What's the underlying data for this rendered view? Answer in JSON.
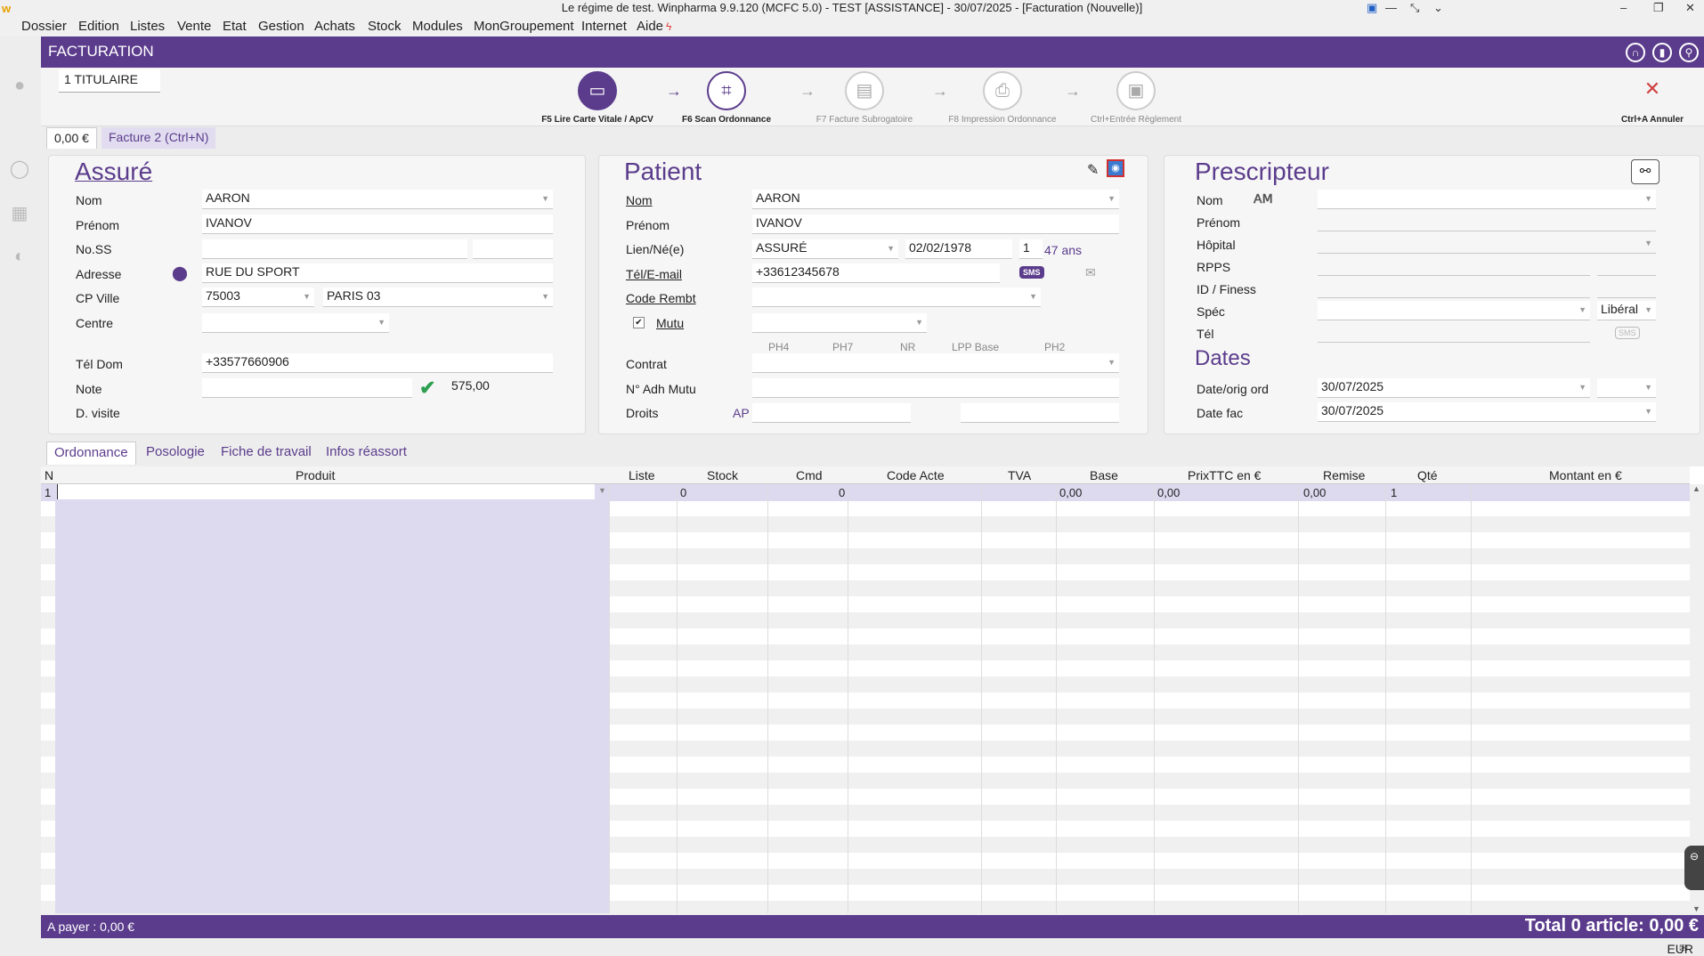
{
  "window": {
    "title": "Le régime de test. Winpharma 9.9.120  (MCFC 5.0) - TEST [ASSISTANCE] - 30/07/2025 - [Facturation (Nouvelle)]"
  },
  "menu": [
    "Dossier",
    "Edition",
    "Listes",
    "Vente",
    "Etat",
    "Gestion",
    "Achats",
    "Stock",
    "Modules",
    "MonGroupement",
    "Internet",
    "Aide"
  ],
  "header": {
    "title": "FACTURATION"
  },
  "titulaire": "1 TITULAIRE",
  "steps": [
    {
      "label": "F5 Lire Carte Vitale / ApCV"
    },
    {
      "label": "F6 Scan Ordonnance"
    },
    {
      "label": "F7 Facture Subrogatoire"
    },
    {
      "label": "F8 Impression Ordonnance"
    },
    {
      "label": "Ctrl+Entrée Règlement"
    }
  ],
  "cancel": {
    "label": "Ctrl+A Annuler"
  },
  "invoice_tabs": {
    "amount": "0,00 €",
    "new": "Facture 2 (Ctrl+N)"
  },
  "assure": {
    "title": "Assuré",
    "nom_label": "Nom",
    "nom": "AARON",
    "prenom_label": "Prénom",
    "prenom": "IVANOV",
    "noss_label": "No.SS",
    "adresse_label": "Adresse",
    "adresse": "RUE DU SPORT",
    "cpville_label": "CP Ville",
    "cp": "75003",
    "ville": "PARIS 03",
    "centre_label": "Centre",
    "teldom_label": "Tél Dom",
    "teldom": "+33577660906",
    "note_label": "Note",
    "note_value": "575,00",
    "dvisite_label": "D. visite"
  },
  "patient": {
    "title": "Patient",
    "nom_label": "Nom",
    "nom": "AARON",
    "prenom_label": "Prénom",
    "prenom": "IVANOV",
    "lien_label": "Lien/Né(e)",
    "lien": "ASSURÉ",
    "naissance": "02/02/1978",
    "rang": "1",
    "age": "47 ans",
    "tel_label": "Tél/E-mail",
    "tel": "+33612345678",
    "sms": "SMS",
    "coderembt_label": "Code Rembt",
    "mutu_label": "Mutu",
    "ph_headers": [
      "PH4",
      "PH7",
      "NR",
      "LPP Base",
      "PH2"
    ],
    "contrat_label": "Contrat",
    "adhmutu_label": "N° Adh Mutu",
    "droits_label": "Droits",
    "droits_ap": "AP"
  },
  "prescripteur": {
    "title": "Prescripteur",
    "nom_label": "Nom",
    "prenom_label": "Prénom",
    "hopital_label": "Hôpital",
    "rpps_label": "RPPS",
    "finess_label": "ID / Finess",
    "spec_label": "Spéc",
    "liberal": "Libéral",
    "tel_label": "Tél",
    "sms": "SMS"
  },
  "dates": {
    "title": "Dates",
    "dateorig_label": "Date/orig ord",
    "dateorig": "30/07/2025",
    "datefac_label": "Date fac",
    "datefac": "30/07/2025"
  },
  "content_tabs": [
    "Ordonnance",
    "Posologie",
    "Fiche de travail",
    "Infos réassort"
  ],
  "grid": {
    "headers": [
      "N",
      "Produit",
      "Liste",
      "Stock",
      "Cmd",
      "Code Acte",
      "TVA",
      "Base",
      "PrixTTC en €",
      "Remise",
      "Qté",
      "Montant en €"
    ],
    "row1": {
      "n": "1",
      "stock": "0",
      "cmd": "0",
      "base": "0,00",
      "prix": "0,00",
      "remise": "0,00",
      "qte": "1"
    }
  },
  "footer": {
    "apayer": "A payer :  0,00 €",
    "total": "Total 0 article:  0,00 €"
  },
  "status": {
    "currency": "EUR"
  },
  "colors": {
    "accent": "#5b3c8c",
    "check": "#2e9e4f"
  }
}
